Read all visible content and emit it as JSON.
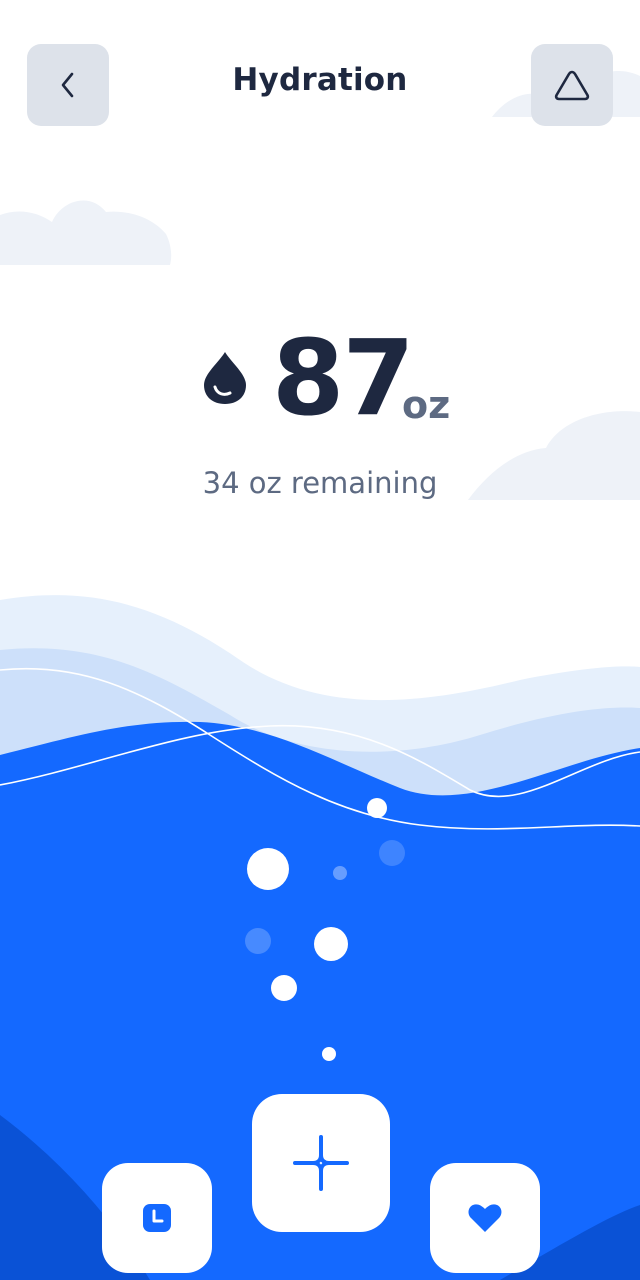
{
  "header": {
    "title": "Hydration",
    "back_icon": "chevron-left-icon",
    "alert_icon": "triangle-icon"
  },
  "reading": {
    "icon": "water-drop-icon",
    "amount": "87",
    "unit": "oz",
    "remaining_text": "34 oz remaining",
    "intake_fraction": 0.72
  },
  "actions": [
    {
      "name": "history",
      "icon": "clock-icon"
    },
    {
      "name": "add",
      "icon": "plus-icon"
    },
    {
      "name": "favorite",
      "icon": "heart-icon"
    }
  ],
  "colors": {
    "background": "#ffffff",
    "water": "#1469ff",
    "water_deep": "#0a52d6",
    "wave_light": "#e6f0fc",
    "wave_mid": "#cde0fa",
    "cloud": "#eef2f8",
    "text_dark": "#1e2840",
    "text_muted": "#5d6a82",
    "button_gray": "#dde2ea"
  }
}
